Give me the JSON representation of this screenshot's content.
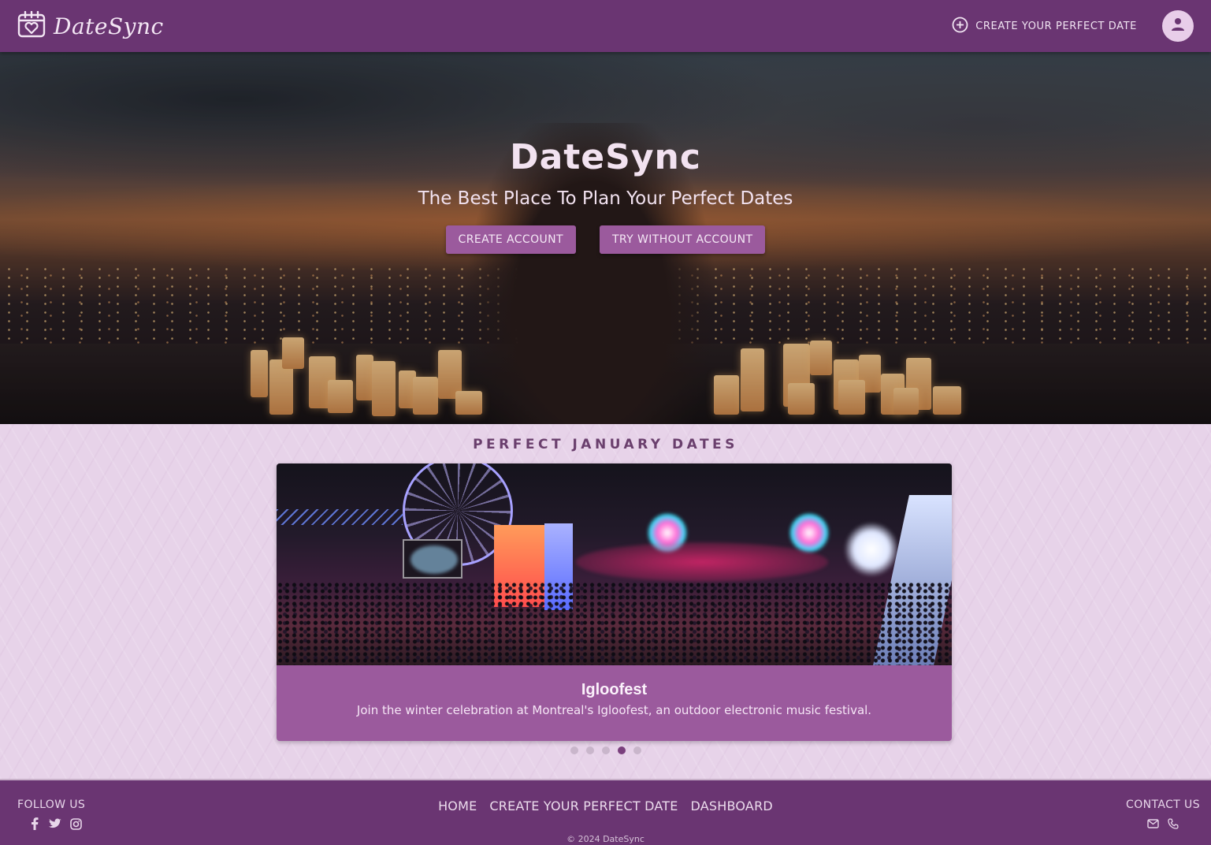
{
  "navbar": {
    "brand": "DateSync",
    "cta_label": "CREATE YOUR PERFECT DATE"
  },
  "hero": {
    "title": "DateSync",
    "subtitle": "The Best Place To Plan Your Perfect Dates",
    "create_account_label": "CREATE ACCOUNT",
    "try_without_label": "TRY WITHOUT ACCOUNT"
  },
  "main": {
    "section_title": "PERFECT JANUARY DATES",
    "card": {
      "title": "Igloofest",
      "description": "Join the winter celebration at Montreal's Igloofest, an outdoor electronic music festival."
    },
    "carousel": {
      "count": 5,
      "active_index": 3
    }
  },
  "footer": {
    "follow_label": "FOLLOW US",
    "nav": {
      "home": "HOME",
      "create": "CREATE YOUR PERFECT DATE",
      "dashboard": "DASHBOARD"
    },
    "contact_label": "CONTACT US",
    "copyright": "© 2024 DateSync"
  },
  "icons": {
    "brand": "calendar-heart-icon",
    "cta": "plus-circle-icon",
    "avatar": "person-icon",
    "social": [
      "facebook-icon",
      "twitter-icon",
      "instagram-icon"
    ],
    "contact": [
      "mail-icon",
      "phone-icon"
    ]
  },
  "colors": {
    "primary": "#6a3572",
    "button": "#9b5a9d",
    "background": "#e7d3e9",
    "active_dot": "#7a3f7d"
  }
}
